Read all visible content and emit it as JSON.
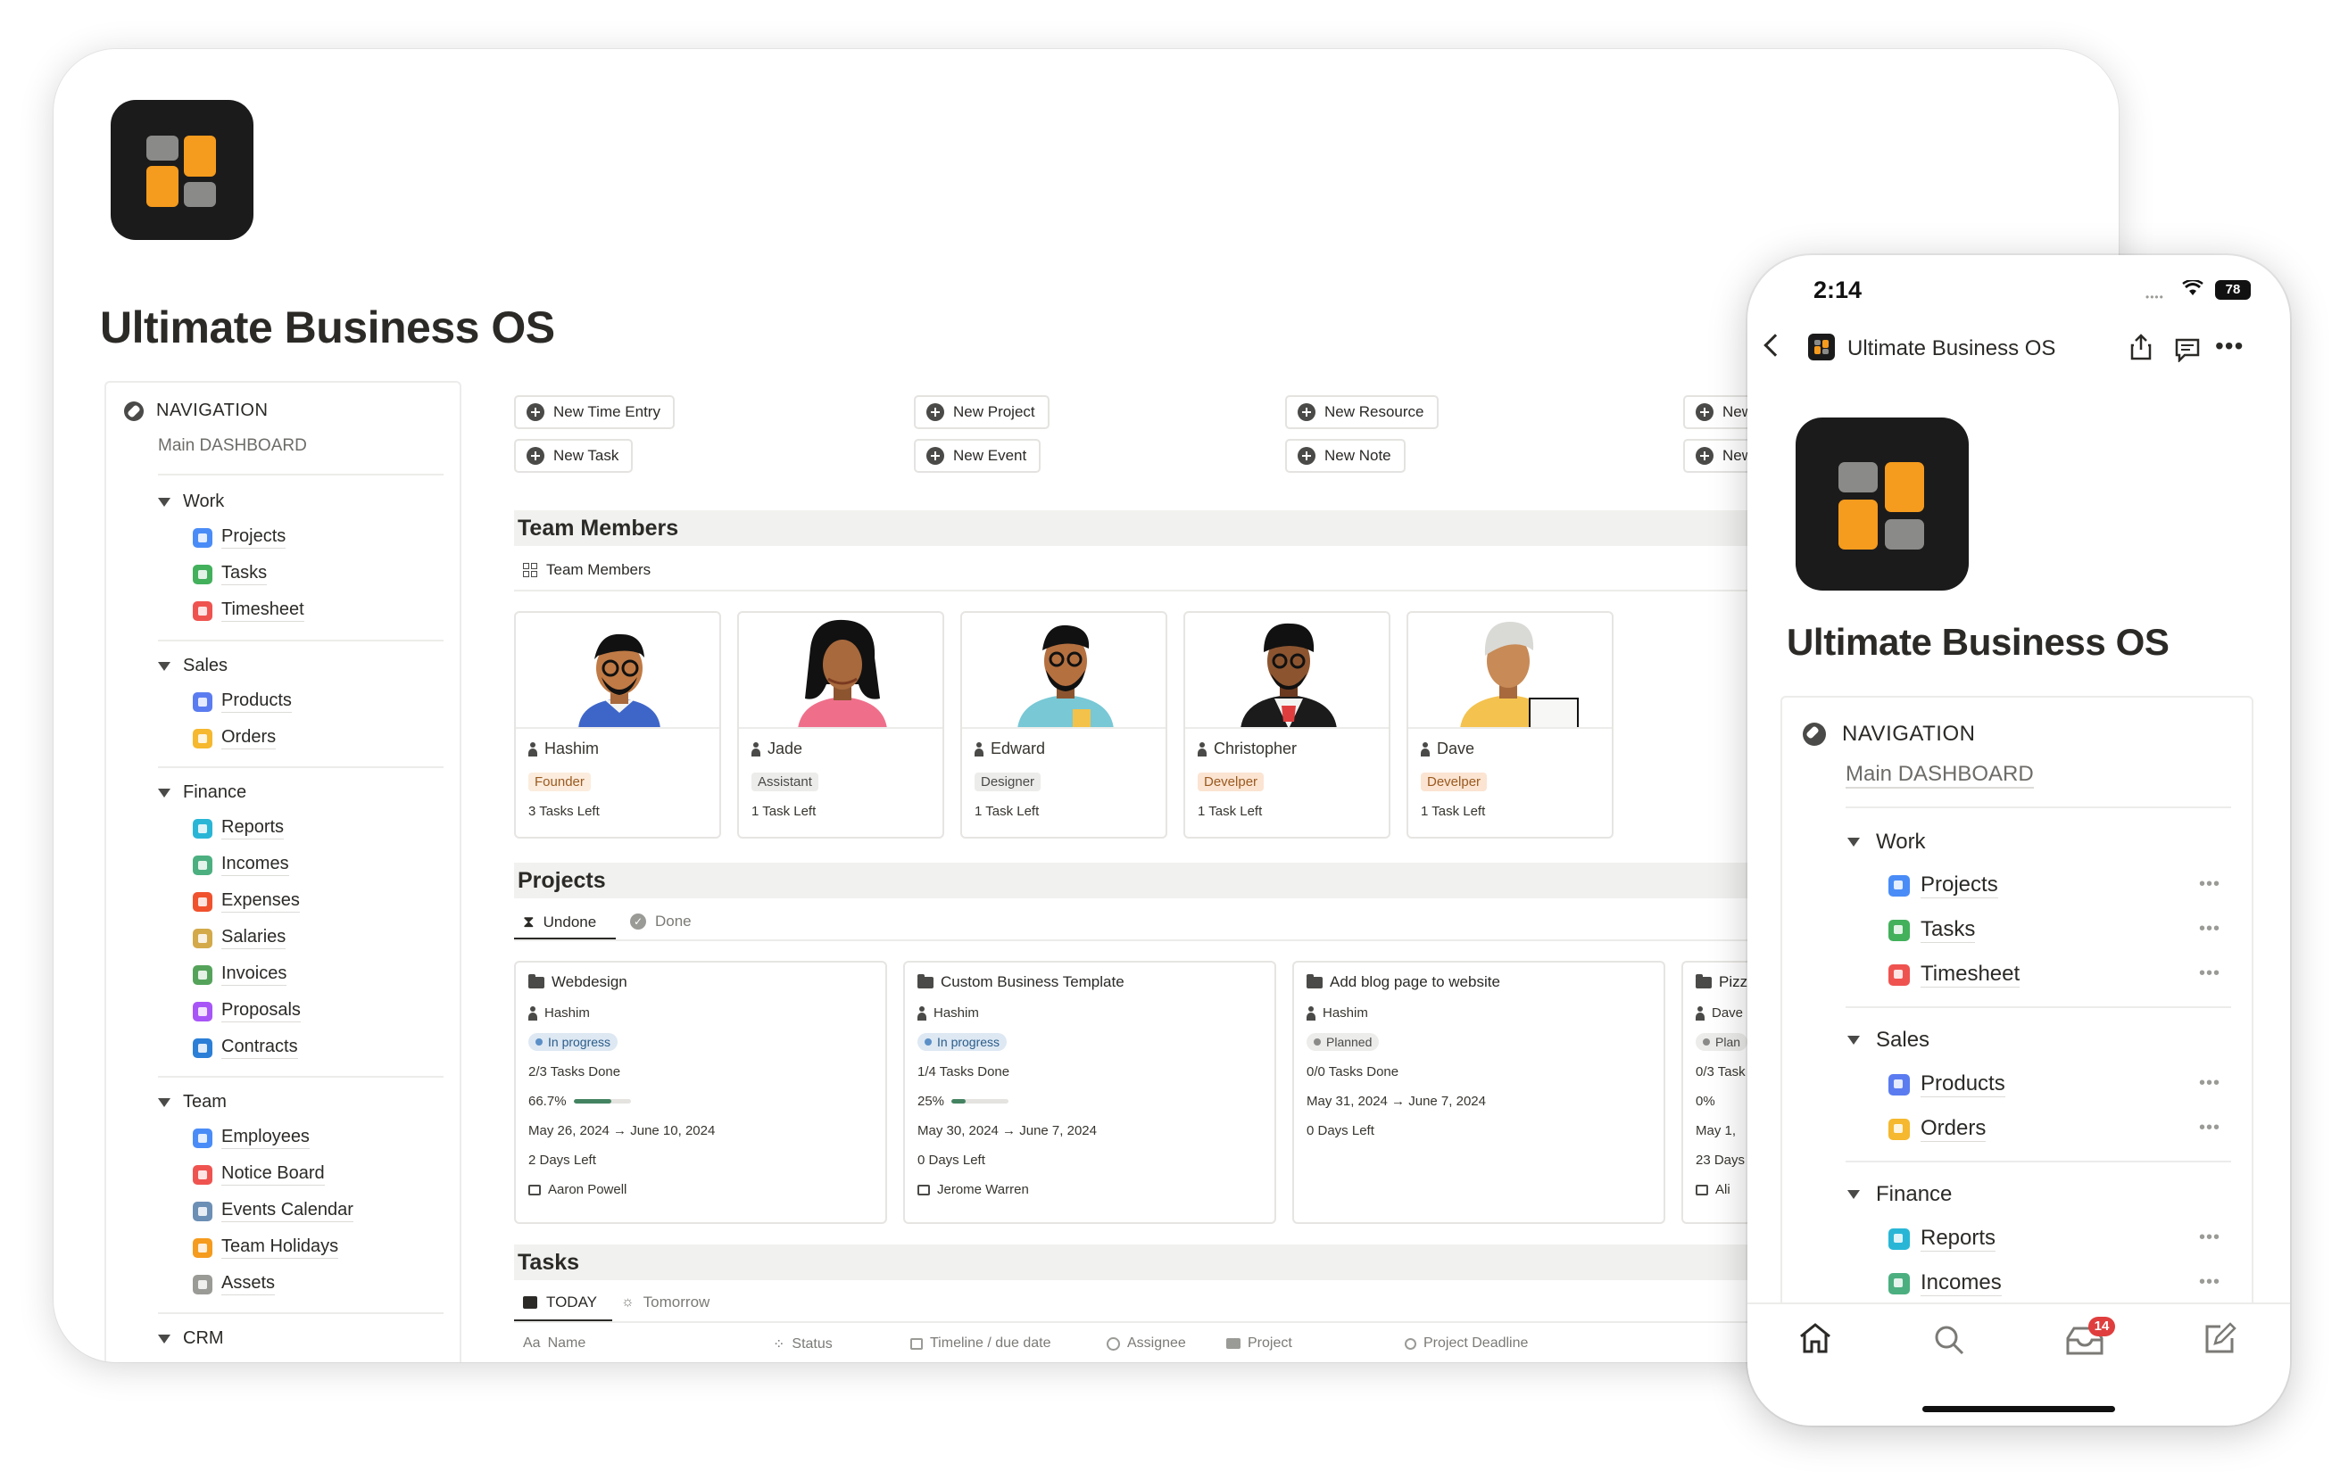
{
  "desktop": {
    "title": "Ultimate Business OS",
    "navigation": {
      "title": "NAVIGATION",
      "subtitle": "Main DASHBOARD",
      "groups": [
        {
          "label": "Work",
          "items": [
            {
              "label": "Projects",
              "color": "#4a8cf7"
            },
            {
              "label": "Tasks",
              "color": "#43b05c"
            },
            {
              "label": "Timesheet",
              "color": "#ef5350"
            }
          ]
        },
        {
          "label": "Sales",
          "items": [
            {
              "label": "Products",
              "color": "#5b7cf0"
            },
            {
              "label": "Orders",
              "color": "#f5b82e"
            }
          ]
        },
        {
          "label": "Finance",
          "items": [
            {
              "label": "Reports",
              "color": "#29b6d6"
            },
            {
              "label": "Incomes",
              "color": "#4caf80"
            },
            {
              "label": "Expenses",
              "color": "#f0522d"
            },
            {
              "label": "Salaries",
              "color": "#d3a94a"
            },
            {
              "label": "Invoices",
              "color": "#55a35b"
            },
            {
              "label": "Proposals",
              "color": "#a855f7"
            },
            {
              "label": "Contracts",
              "color": "#2b7fd6"
            }
          ]
        },
        {
          "label": "Team",
          "items": [
            {
              "label": "Employees",
              "color": "#4a8cf7"
            },
            {
              "label": "Notice Board",
              "color": "#ef5350"
            },
            {
              "label": "Events Calendar",
              "color": "#6c8fb5"
            },
            {
              "label": "Team Holidays",
              "color": "#f59b1d"
            },
            {
              "label": "Assets",
              "color": "#9a9a96"
            }
          ]
        },
        {
          "label": "CRM",
          "items": []
        }
      ]
    },
    "quick_actions": [
      "New Time Entry",
      "New Task",
      "New Project",
      "New Event",
      "New Resource",
      "New Note",
      "New",
      "New"
    ],
    "team": {
      "heading": "Team Members",
      "view_label": "Team Members",
      "members": [
        {
          "name": "Hashim",
          "role": "Founder",
          "role_bg": "#fbecdd",
          "role_fg": "#9a5a20",
          "tasks": "3 Tasks Left"
        },
        {
          "name": "Jade",
          "role": "Assistant",
          "role_bg": "#ececea",
          "role_fg": "#4a4a48",
          "tasks": "1 Task Left"
        },
        {
          "name": "Edward",
          "role": "Designer",
          "role_bg": "#ececea",
          "role_fg": "#4a4a48",
          "tasks": "1 Task Left"
        },
        {
          "name": "Christopher",
          "role": "Develper",
          "role_bg": "#fbe4d2",
          "role_fg": "#9a5a20",
          "tasks": "1 Task Left"
        },
        {
          "name": "Dave",
          "role": "Develper",
          "role_bg": "#fbe4d2",
          "role_fg": "#9a5a20",
          "tasks": "1 Task Left"
        }
      ]
    },
    "projects": {
      "heading": "Projects",
      "tabs": [
        "Undone",
        "Done"
      ],
      "cards": [
        {
          "title": "Webdesign",
          "owner": "Hashim",
          "status": "In progress",
          "tasks": "2/3 Tasks Done",
          "percent": "66.7%",
          "progress": 0.667,
          "dates": "May 26, 2024 → June 10, 2024",
          "left": "2 Days Left",
          "client": "Aaron Powell"
        },
        {
          "title": "Custom Business Template",
          "owner": "Hashim",
          "status": "In progress",
          "tasks": "1/4 Tasks Done",
          "percent": "25%",
          "progress": 0.25,
          "dates": "May 30, 2024 → June 7, 2024",
          "left": "0 Days Left",
          "client": "Jerome Warren"
        },
        {
          "title": "Add blog page to website",
          "owner": "Hashim",
          "status": "Planned",
          "tasks": "0/0 Tasks Done",
          "percent": "",
          "progress": null,
          "dates": "May 31, 2024 → June 7, 2024",
          "left": "0 Days Left",
          "client": ""
        },
        {
          "title": "Pizz",
          "owner": "Dave",
          "status": "Plan",
          "tasks": "0/3 Task",
          "percent": "0%",
          "progress": 0,
          "dates": "May 1,",
          "left": "23 Days",
          "client": "Ali"
        }
      ]
    },
    "tasks": {
      "heading": "Tasks",
      "tabs": [
        "TODAY",
        "Tomorrow"
      ],
      "columns": [
        "Name",
        "Status",
        "Timeline / due date",
        "Assignee",
        "Project",
        "Project Deadline"
      ],
      "name_prefix": "Aa"
    }
  },
  "phone": {
    "time": "2:14",
    "battery": "78",
    "header_title": "Ultimate Business OS",
    "title": "Ultimate Business OS",
    "nav_title": "NAVIGATION",
    "nav_subtitle": "Main DASHBOARD",
    "groups": [
      {
        "label": "Work",
        "items": [
          {
            "label": "Projects",
            "color": "#4a8cf7"
          },
          {
            "label": "Tasks",
            "color": "#43b05c"
          },
          {
            "label": "Timesheet",
            "color": "#ef5350"
          }
        ]
      },
      {
        "label": "Sales",
        "items": [
          {
            "label": "Products",
            "color": "#5b7cf0"
          },
          {
            "label": "Orders",
            "color": "#f5b82e"
          }
        ]
      },
      {
        "label": "Finance",
        "items": [
          {
            "label": "Reports",
            "color": "#29b6d6"
          },
          {
            "label": "Incomes",
            "color": "#4caf80"
          }
        ]
      }
    ],
    "inbox_badge": "14"
  }
}
